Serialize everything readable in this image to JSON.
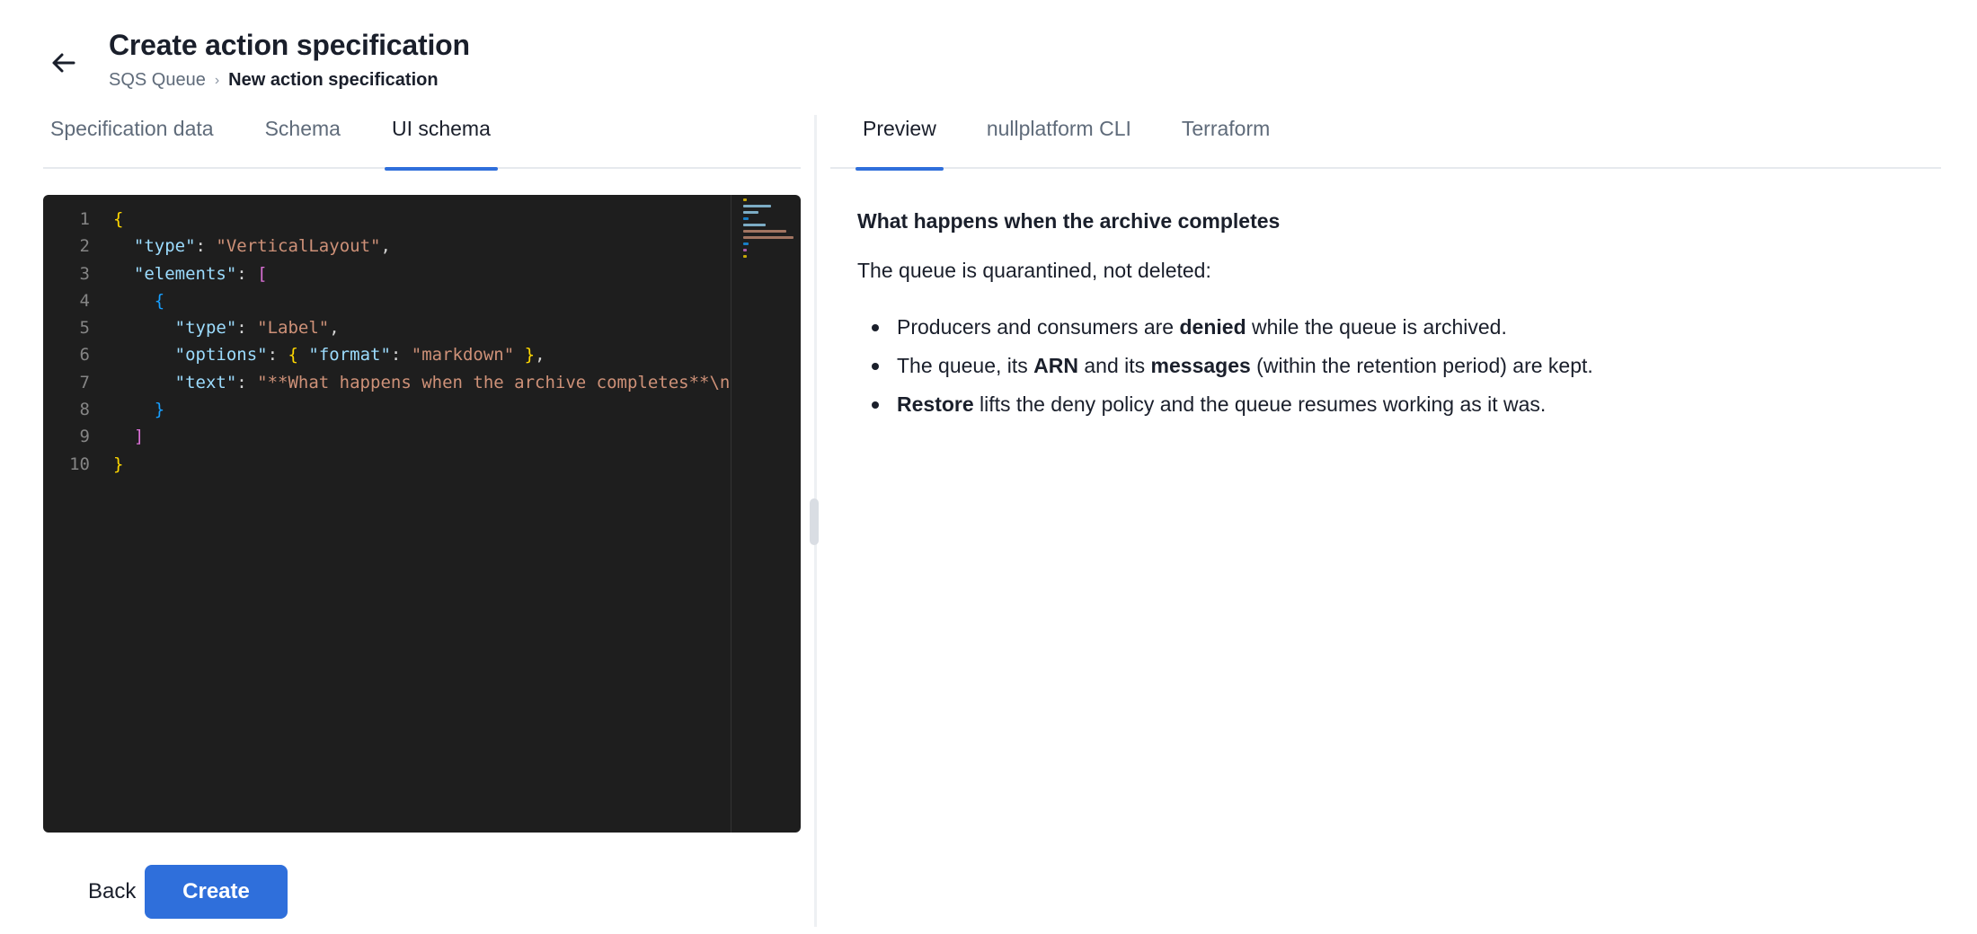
{
  "header": {
    "title": "Create action specification",
    "breadcrumb": {
      "parent": "SQS Queue",
      "separator": "›",
      "current": "New action specification"
    }
  },
  "left_tabs": [
    {
      "label": "Specification data",
      "active": false
    },
    {
      "label": "Schema",
      "active": false
    },
    {
      "label": "UI schema",
      "active": true
    }
  ],
  "editor": {
    "line_numbers": [
      "1",
      "2",
      "3",
      "4",
      "5",
      "6",
      "7",
      "8",
      "9",
      "10"
    ],
    "lines": [
      [
        {
          "t": "{",
          "c": "b1"
        }
      ],
      [
        {
          "t": "  "
        },
        {
          "t": "\"type\"",
          "c": "key"
        },
        {
          "t": ": ",
          "c": "p"
        },
        {
          "t": "\"VerticalLayout\"",
          "c": "str"
        },
        {
          "t": ",",
          "c": "p"
        }
      ],
      [
        {
          "t": "  "
        },
        {
          "t": "\"elements\"",
          "c": "key"
        },
        {
          "t": ": ",
          "c": "p"
        },
        {
          "t": "[",
          "c": "b2"
        }
      ],
      [
        {
          "t": "    "
        },
        {
          "t": "{",
          "c": "b3"
        }
      ],
      [
        {
          "t": "      "
        },
        {
          "t": "\"type\"",
          "c": "key"
        },
        {
          "t": ": ",
          "c": "p"
        },
        {
          "t": "\"Label\"",
          "c": "str"
        },
        {
          "t": ",",
          "c": "p"
        }
      ],
      [
        {
          "t": "      "
        },
        {
          "t": "\"options\"",
          "c": "key"
        },
        {
          "t": ": ",
          "c": "p"
        },
        {
          "t": "{ ",
          "c": "b1"
        },
        {
          "t": "\"format\"",
          "c": "key"
        },
        {
          "t": ": ",
          "c": "p"
        },
        {
          "t": "\"markdown\"",
          "c": "str"
        },
        {
          "t": " }",
          "c": "b1"
        },
        {
          "t": ",",
          "c": "p"
        }
      ],
      [
        {
          "t": "      "
        },
        {
          "t": "\"text\"",
          "c": "key"
        },
        {
          "t": ": ",
          "c": "p"
        },
        {
          "t": "\"**What happens when the archive completes**\\n",
          "c": "str"
        }
      ],
      [
        {
          "t": "    "
        },
        {
          "t": "}",
          "c": "b3"
        }
      ],
      [
        {
          "t": "  "
        },
        {
          "t": "]",
          "c": "b2"
        }
      ],
      [
        {
          "t": "}",
          "c": "b1"
        }
      ]
    ],
    "minimap_colors": [
      "#ffd700",
      "#9cdcfe",
      "#9cdcfe",
      "#179fff",
      "#9cdcfe",
      "#ce9178",
      "#ce9178",
      "#179fff",
      "#da70d6",
      "#ffd700"
    ]
  },
  "footer": {
    "back_label": "Back",
    "create_label": "Create"
  },
  "right_tabs": [
    {
      "label": "Preview",
      "active": true
    },
    {
      "label": "nullplatform CLI",
      "active": false
    },
    {
      "label": "Terraform",
      "active": false
    }
  ],
  "preview": {
    "heading": "What happens when the archive completes",
    "paragraph": "The queue is quarantined, not deleted:",
    "bullets": [
      [
        {
          "t": "Producers and consumers are "
        },
        {
          "t": "denied",
          "b": true
        },
        {
          "t": " while the queue is archived."
        }
      ],
      [
        {
          "t": "The queue, its "
        },
        {
          "t": "ARN",
          "b": true
        },
        {
          "t": " and its "
        },
        {
          "t": "messages",
          "b": true
        },
        {
          "t": " (within the retention period) are kept."
        }
      ],
      [
        {
          "t": "Restore",
          "b": true
        },
        {
          "t": " lifts the deny policy and the queue resumes working as it was."
        }
      ]
    ]
  },
  "colors": {
    "accent": "#2f6fdb",
    "editor_bg": "#1e1e1e"
  }
}
